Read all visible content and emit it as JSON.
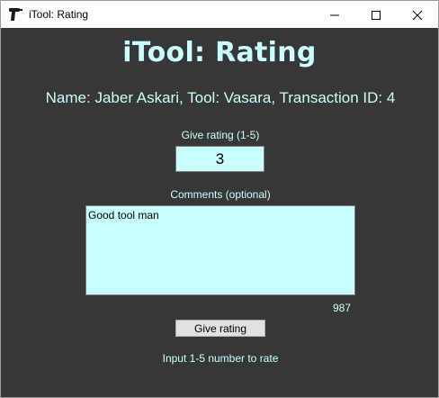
{
  "window": {
    "title": "iTool: Rating",
    "icon": "drill-icon",
    "controls": [
      "minimize-icon",
      "maximize-icon",
      "close-icon"
    ]
  },
  "heading": "iTool: Rating",
  "info_line": "Name: Jaber Askari, Tool: Vasara, Transaction ID: 4",
  "rating": {
    "label": "Give rating (1-5)",
    "value": "3"
  },
  "comments": {
    "label": "Comments (optional)",
    "value": "Good tool man",
    "remaining": "987"
  },
  "submit_label": "Give rating",
  "status": "Input 1-5 number to rate",
  "colors": {
    "background": "#373737",
    "accent_text": "#c9ffff",
    "field_background": "#c9ffff",
    "button_background": "#e1e1e1"
  }
}
